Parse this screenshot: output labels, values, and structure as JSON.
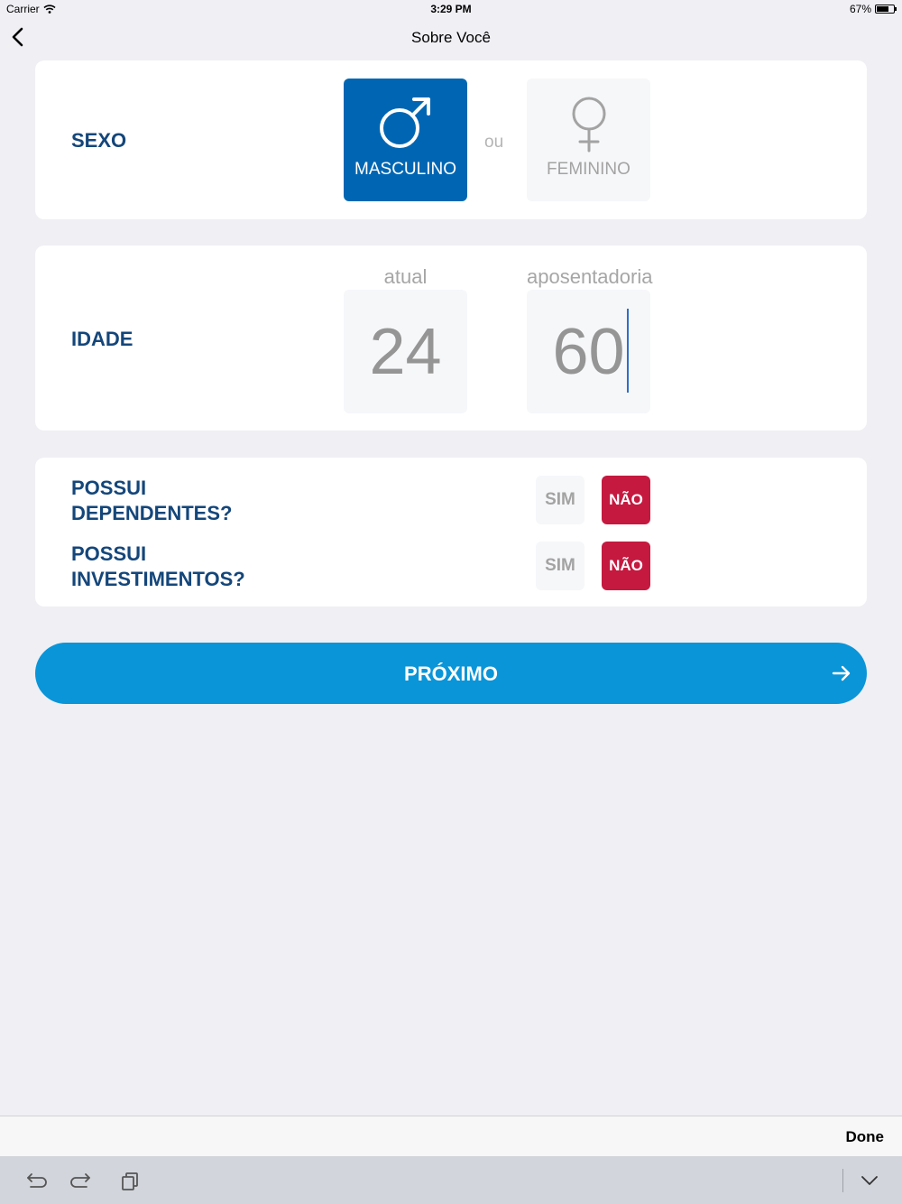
{
  "status_bar": {
    "carrier": "Carrier",
    "time": "3:29 PM",
    "battery": "67%"
  },
  "nav": {
    "title": "Sobre Você",
    "back_icon": "chevron-left-icon"
  },
  "sexo": {
    "label": "SEXO",
    "options": [
      {
        "label": "MASCULINO",
        "icon": "male-symbol-icon",
        "selected": true
      },
      {
        "label": "FEMININO",
        "icon": "female-symbol-icon",
        "selected": false
      }
    ],
    "separator": "ou"
  },
  "idade": {
    "label": "IDADE",
    "atual": {
      "caption": "atual",
      "value": "24"
    },
    "aposentadoria": {
      "caption": "aposentadoria",
      "value": "60"
    }
  },
  "questions": [
    {
      "label_line1": "POSSUI",
      "label_line2": "DEPENDENTES?",
      "yes": "SIM",
      "no": "NÃO",
      "selected": "no"
    },
    {
      "label_line1": "POSSUI",
      "label_line2": "INVESTIMENTOS?",
      "yes": "SIM",
      "no": "NÃO",
      "selected": "no"
    }
  ],
  "next_button": {
    "label": "PRÓXIMO",
    "icon": "arrow-right-icon"
  },
  "keyboard_accessory": {
    "done": "Done"
  },
  "keyboard_bar": {
    "icons": [
      "undo-icon",
      "redo-icon",
      "paste-icon",
      "keyboard-dismiss-icon"
    ]
  },
  "colors": {
    "background": "#efeff4",
    "label_blue": "#14467a",
    "selected_blue": "#0066b3",
    "button_blue": "#0a95d8",
    "no_red": "#c5193f"
  }
}
